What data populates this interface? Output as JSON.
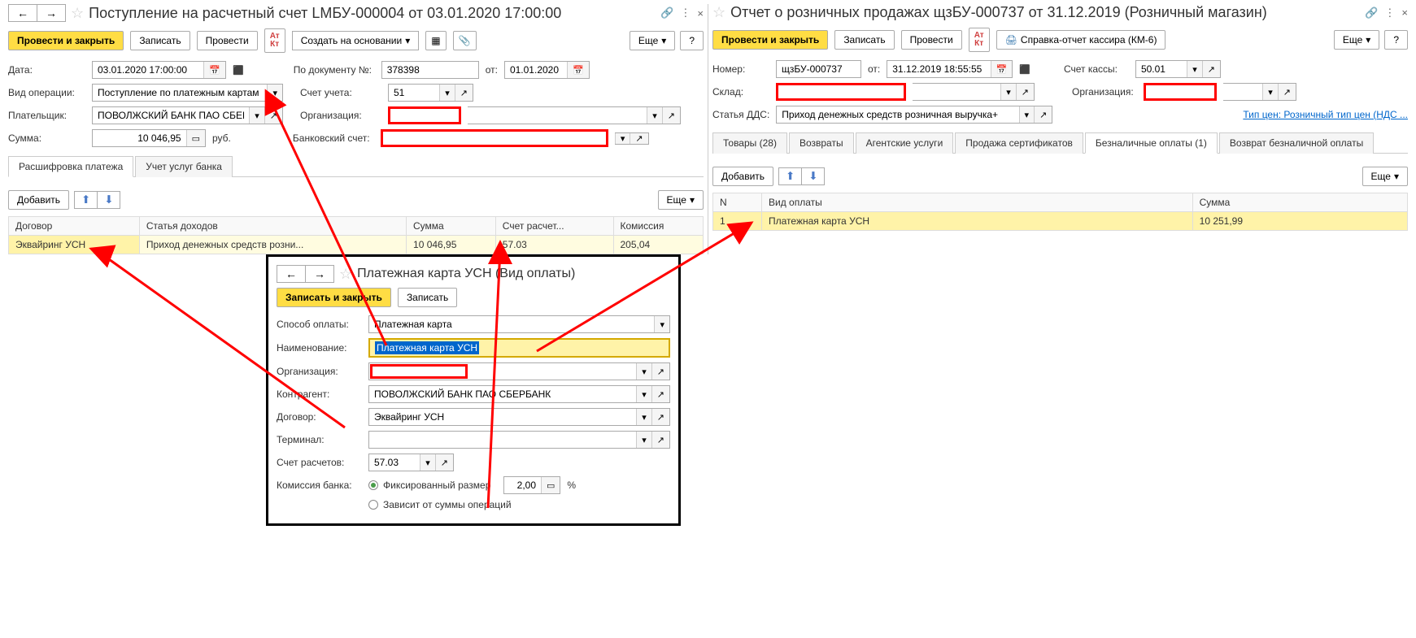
{
  "left": {
    "title": "Поступление на расчетный счет LМБУ-000004 от 03.01.2020 17:00:00",
    "toolbar": {
      "post_close": "Провести и закрыть",
      "write": "Записать",
      "post": "Провести",
      "create_based": "Создать на основании",
      "more": "Еще"
    },
    "fields": {
      "date_lbl": "Дата:",
      "date_val": "03.01.2020 17:00:00",
      "doc_no_lbl": "По документу №:",
      "doc_no_val": "378398",
      "from_lbl": "от:",
      "from_val": "01.01.2020",
      "op_type_lbl": "Вид операции:",
      "op_type_val": "Поступление по платежным картам",
      "account_lbl": "Счет учета:",
      "account_val": "51",
      "payer_lbl": "Плательщик:",
      "payer_val": "ПОВОЛЖСКИЙ БАНК ПАО СБЕРБА",
      "org_lbl": "Организация:",
      "sum_lbl": "Сумма:",
      "sum_val": "10 046,95",
      "sum_cur": "руб.",
      "bank_acc_lbl": "Банковский счет:"
    },
    "tabs": {
      "t1": "Расшифровка платежа",
      "t2": "Учет услуг банка"
    },
    "table_toolbar": {
      "add": "Добавить",
      "more": "Еще"
    },
    "table": {
      "h1": "Договор",
      "h2": "Статья доходов",
      "h3": "Сумма",
      "h4": "Счет расчет...",
      "h5": "Комиссия",
      "r1c1": "Эквайринг УСН",
      "r1c2": "Приход денежных средств розни...",
      "r1c3": "10 046,95",
      "r1c4": "57.03",
      "r1c5": "205,04"
    }
  },
  "right": {
    "title": "Отчет о розничных продажах щзБУ-000737 от 31.12.2019 (Розничный магазин)",
    "toolbar": {
      "post_close": "Провести и закрыть",
      "write": "Записать",
      "post": "Провести",
      "km6": "Справка-отчет кассира (КМ-6)",
      "more": "Еще"
    },
    "fields": {
      "num_lbl": "Номер:",
      "num_val": "щзБУ-000737",
      "from_lbl": "от:",
      "from_val": "31.12.2019 18:55:55",
      "kassa_lbl": "Счет кассы:",
      "kassa_val": "50.01",
      "sklad_lbl": "Склад:",
      "org_lbl": "Организация:",
      "dds_lbl": "Статья ДДС:",
      "dds_val": "Приход денежных средств розничная выручка+",
      "price_link": "Тип цен: Розничный тип цен (НДС ..."
    },
    "tabs": {
      "t1": "Товары (28)",
      "t2": "Возвраты",
      "t3": "Агентские услуги",
      "t4": "Продажа сертификатов",
      "t5": "Безналичные оплаты (1)",
      "t6": "Возврат безналичной оплаты"
    },
    "table_toolbar": {
      "add": "Добавить",
      "more": "Еще"
    },
    "table": {
      "h1": "N",
      "h2": "Вид оплаты",
      "h3": "Сумма",
      "r1c1": "1",
      "r1c2": "Платежная карта УСН",
      "r1c3": "10 251,99"
    }
  },
  "popup": {
    "title": "Платежная карта УСН (Вид оплаты)",
    "toolbar": {
      "write_close": "Записать и закрыть",
      "write": "Записать"
    },
    "fields": {
      "method_lbl": "Способ оплаты:",
      "method_val": "Платежная карта",
      "name_lbl": "Наименование:",
      "name_val": "Платежная карта УСН",
      "org_lbl": "Организация:",
      "agent_lbl": "Контрагент:",
      "agent_val": "ПОВОЛЖСКИЙ БАНК ПАО СБЕРБАНК",
      "contract_lbl": "Договор:",
      "contract_val": "Эквайринг УСН",
      "terminal_lbl": "Терминал:",
      "settle_lbl": "Счет расчетов:",
      "settle_val": "57.03",
      "commission_lbl": "Комиссия банка:",
      "fixed_lbl": "Фиксированный размер",
      "fixed_val": "2,00",
      "pct": "%",
      "depends_lbl": "Зависит от суммы операций"
    }
  }
}
